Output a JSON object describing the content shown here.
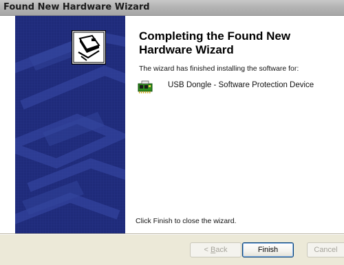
{
  "window": {
    "title": "Found New Hardware Wizard"
  },
  "content": {
    "heading": "Completing the Found New Hardware Wizard",
    "info": "The wizard has finished installing the software for:",
    "device_name": "USB Dongle - Software Protection Device",
    "close_hint": "Click Finish to close the wizard."
  },
  "buttons": {
    "back_prefix": "< ",
    "back_accel": "B",
    "back_rest": "ack",
    "finish": "Finish",
    "cancel": "Cancel"
  },
  "icons": {
    "wizard": "hardware-wizard-icon",
    "device": "usb-device-icon"
  },
  "colors": {
    "side_panel": "#1f2b7a",
    "button_face": "#ece9d8"
  }
}
